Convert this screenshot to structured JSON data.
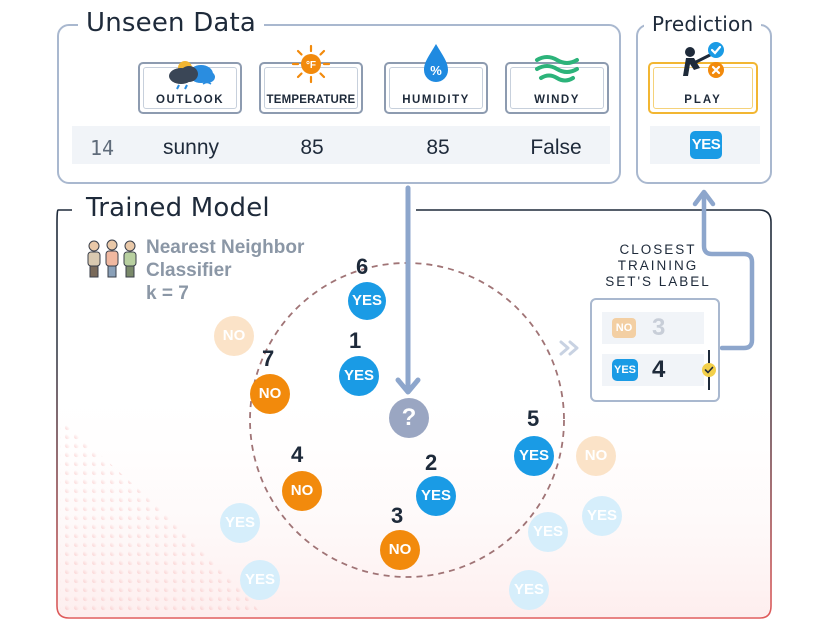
{
  "unseen": {
    "title": "Unseen Data",
    "features": [
      {
        "label": "OUTLOOK",
        "icon": "cloud-sun-icon"
      },
      {
        "label": "TEMPERATURE",
        "icon": "sun-thermometer-icon"
      },
      {
        "label": "HUMIDITY",
        "icon": "water-drop-percent-icon"
      },
      {
        "label": "WINDY",
        "icon": "wind-icon"
      }
    ],
    "row": {
      "id": "14",
      "outlook": "sunny",
      "temperature": "85",
      "humidity": "85",
      "windy": "False"
    }
  },
  "prediction": {
    "title": "Prediction",
    "label": "PLAY",
    "icon": "golfer-icon",
    "value": "YES"
  },
  "model": {
    "title": "Trained Model",
    "line1": "Nearest Neighbor",
    "line2": "Classifier",
    "k_label": "k = 7",
    "icon": "people-group-icon",
    "query_symbol": "?"
  },
  "neighbors": [
    {
      "rank": "1",
      "label": "YES"
    },
    {
      "rank": "2",
      "label": "YES"
    },
    {
      "rank": "3",
      "label": "NO"
    },
    {
      "rank": "4",
      "label": "NO"
    },
    {
      "rank": "5",
      "label": "YES"
    },
    {
      "rank": "6",
      "label": "YES"
    },
    {
      "rank": "7",
      "label": "NO"
    }
  ],
  "others": {
    "no": "NO",
    "yes": "YES"
  },
  "closest": {
    "title_line1": "CLOSEST",
    "title_line2": "TRAINING",
    "title_line3": "SET'S LABEL",
    "rows": [
      {
        "label": "NO",
        "count": "3"
      },
      {
        "label": "YES",
        "count": "4"
      }
    ]
  },
  "colors": {
    "yes": "#1a9be5",
    "no": "#f28a0c",
    "panel_border": "#a9b8cf",
    "model_border": "#1e2a3a",
    "accent_red": "#e05b5b"
  }
}
